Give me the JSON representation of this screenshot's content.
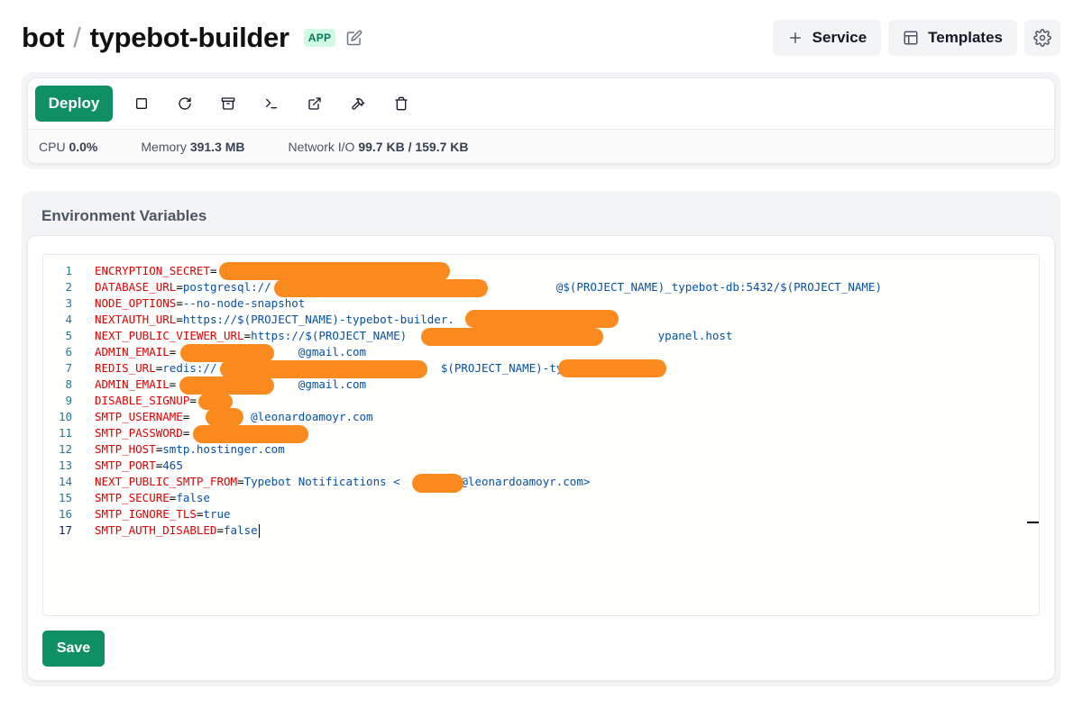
{
  "header": {
    "project": "bot",
    "separator": "/",
    "service": "typebot-builder",
    "badge": "APP",
    "actions": {
      "service_label": "Service",
      "templates_label": "Templates"
    }
  },
  "toolbar": {
    "deploy_label": "Deploy",
    "icons": [
      "stop-icon",
      "restart-icon",
      "archive-icon",
      "terminal-icon",
      "external-link-icon",
      "hammer-icon",
      "trash-icon"
    ]
  },
  "stats": {
    "cpu_label": "CPU",
    "cpu_value": "0.0%",
    "memory_label": "Memory",
    "memory_value": "391.3 MB",
    "network_label": "Network I/O",
    "network_value": "99.7 KB / 159.7 KB"
  },
  "env": {
    "title": "Environment Variables",
    "save_label": "Save",
    "lines": [
      {
        "n": "1",
        "key": "ENCRYPTION_SECRET",
        "eq": "=",
        "val": ""
      },
      {
        "n": "2",
        "key": "DATABASE_URL",
        "eq": "=",
        "val": "postgresql://                                          @$(PROJECT_NAME)_typebot-db:5432/$(PROJECT_NAME)"
      },
      {
        "n": "3",
        "key": "NODE_OPTIONS",
        "eq": "=",
        "val": "--no-node-snapshot"
      },
      {
        "n": "4",
        "key": "NEXTAUTH_URL",
        "eq": "=",
        "val": "https://$(PROJECT_NAME)-typebot-builder."
      },
      {
        "n": "5",
        "key": "NEXT_PUBLIC_VIEWER_URL",
        "eq": "=",
        "val": "https://$(PROJECT_NAME)                                     ypanel.host"
      },
      {
        "n": "6",
        "key": "ADMIN_EMAIL",
        "eq": "=",
        "val": "                  @gmail.com"
      },
      {
        "n": "7",
        "key": "REDIS_URL",
        "eq": "=",
        "val": "redis://                                 $(PROJECT_NAME)-typ"
      },
      {
        "n": "8",
        "key": "ADMIN_EMAIL",
        "eq": "=",
        "val": "                  @gmail.com"
      },
      {
        "n": "9",
        "key": "DISABLE_SIGNUP",
        "eq": "=",
        "val": ""
      },
      {
        "n": "10",
        "key": "SMTP_USERNAME",
        "eq": "=",
        "val": "         @leonardoamoyr.com"
      },
      {
        "n": "11",
        "key": "SMTP_PASSWORD",
        "eq": "=",
        "val": ""
      },
      {
        "n": "12",
        "key": "SMTP_HOST",
        "eq": "=",
        "val": "smtp.hostinger.com"
      },
      {
        "n": "13",
        "key": "SMTP_PORT",
        "eq": "=",
        "val": "465"
      },
      {
        "n": "14",
        "key": "NEXT_PUBLIC_SMTP_FROM",
        "eq": "=",
        "val": "Typebot Notifications <         @leonardoamoyr.com>"
      },
      {
        "n": "15",
        "key": "SMTP_SECURE",
        "eq": "=",
        "val": "false"
      },
      {
        "n": "16",
        "key": "SMTP_IGNORE_TLS",
        "eq": "=",
        "val": "true"
      },
      {
        "n": "17",
        "key": "SMTP_AUTH_DISABLED",
        "eq": "=",
        "val": "false"
      }
    ]
  },
  "colors": {
    "accent": "#0f8f64",
    "env_key": "#e00000",
    "env_value": "#0451a5",
    "redaction": "#fb8a1e",
    "badge_bg": "#d1fae5",
    "badge_text": "#047857"
  }
}
